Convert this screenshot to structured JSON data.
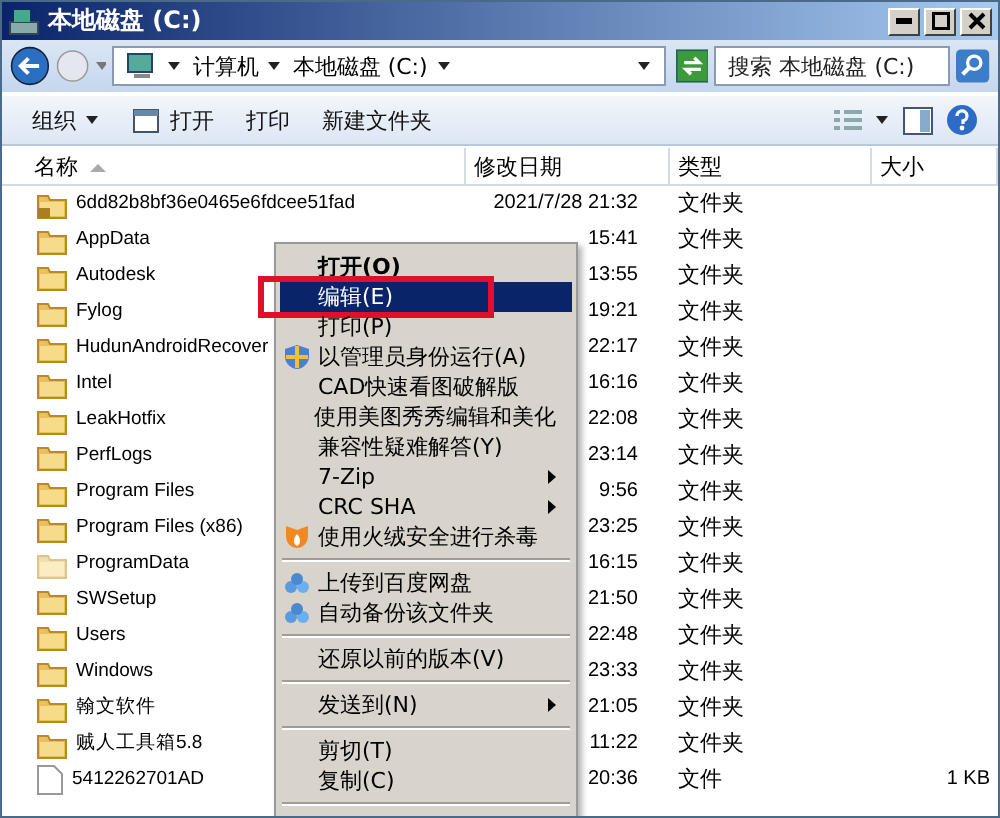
{
  "window": {
    "title": "本地磁盘 (C:)"
  },
  "address": {
    "crumbs": [
      "计算机",
      "本地磁盘 (C:)"
    ]
  },
  "search": {
    "placeholder": "搜索 本地磁盘 (C:)"
  },
  "toolbar": [
    {
      "label": "组织",
      "kind": "menu"
    },
    {
      "label": "打开",
      "kind": "icon"
    },
    {
      "label": "打印",
      "kind": "plain"
    },
    {
      "label": "新建文件夹",
      "kind": "plain"
    }
  ],
  "columns": [
    "名称",
    "修改日期",
    "类型",
    "大小"
  ],
  "rows": [
    {
      "name": "6dd82b8bf36e0465e6fdcee51fad",
      "date": "2021/7/28 21:32",
      "type": "文件夹",
      "kind": "locked"
    },
    {
      "name": "AppData",
      "date": "15:41",
      "type": "文件夹",
      "kind": "folder"
    },
    {
      "name": "Autodesk",
      "date": "13:55",
      "type": "文件夹",
      "kind": "folder"
    },
    {
      "name": "Fylog",
      "date": "19:21",
      "type": "文件夹",
      "kind": "folder"
    },
    {
      "name": "HudunAndroidRecover",
      "date": "22:17",
      "type": "文件夹",
      "kind": "folder"
    },
    {
      "name": "Intel",
      "date": "16:16",
      "type": "文件夹",
      "kind": "folder"
    },
    {
      "name": "LeakHotfix",
      "date": "22:08",
      "type": "文件夹",
      "kind": "folder"
    },
    {
      "name": "PerfLogs",
      "date": "23:14",
      "type": "文件夹",
      "kind": "folder"
    },
    {
      "name": "Program Files",
      "date": "9:56",
      "type": "文件夹",
      "kind": "folder"
    },
    {
      "name": "Program Files (x86)",
      "date": "23:25",
      "type": "文件夹",
      "kind": "folder"
    },
    {
      "name": "ProgramData",
      "date": "16:15",
      "type": "文件夹",
      "kind": "hidden"
    },
    {
      "name": "SWSetup",
      "date": "21:50",
      "type": "文件夹",
      "kind": "folder"
    },
    {
      "name": "Users",
      "date": "22:48",
      "type": "文件夹",
      "kind": "folder"
    },
    {
      "name": "Windows",
      "date": "23:33",
      "type": "文件夹",
      "kind": "folder"
    },
    {
      "name": "翰文软件",
      "date": "21:05",
      "type": "文件夹",
      "kind": "folder"
    },
    {
      "name": "贼人工具箱5.8",
      "date": "11:22",
      "type": "文件夹",
      "kind": "folder"
    },
    {
      "name": "5412262701AD",
      "date": "20:36",
      "type": "文件",
      "size": "1 KB",
      "kind": "file"
    }
  ],
  "context_menu": [
    {
      "kind": "plain",
      "label": "打开(O)",
      "default": true,
      "selected": false
    },
    {
      "kind": "plain",
      "label": "编辑(E)",
      "selected": true
    },
    {
      "kind": "plain",
      "label": "打印(P)",
      "selected": false
    },
    {
      "kind": "shield",
      "label": "以管理员身份运行(A)",
      "selected": false
    },
    {
      "kind": "plain",
      "label": "CAD快速看图破解版",
      "selected": false
    },
    {
      "kind": "plain",
      "label": "使用美图秀秀编辑和美化",
      "selected": false
    },
    {
      "kind": "plain",
      "label": "兼容性疑难解答(Y)",
      "selected": false
    },
    {
      "kind": "plain",
      "label": "7-Zip",
      "submenu": true,
      "selected": false
    },
    {
      "kind": "plain",
      "label": "CRC SHA",
      "submenu": true,
      "selected": false
    },
    {
      "kind": "flame",
      "label": "使用火绒安全进行杀毒",
      "selected": false
    },
    {
      "kind": "separator"
    },
    {
      "kind": "cloud",
      "label": "上传到百度网盘",
      "selected": false
    },
    {
      "kind": "cloud",
      "label": "自动备份该文件夹",
      "selected": false
    },
    {
      "kind": "separator"
    },
    {
      "kind": "plain",
      "label": "还原以前的版本(V)",
      "selected": false
    },
    {
      "kind": "separator"
    },
    {
      "kind": "plain",
      "label": "发送到(N)",
      "submenu": true,
      "selected": false
    },
    {
      "kind": "separator"
    },
    {
      "kind": "plain",
      "label": "剪切(T)",
      "selected": false
    },
    {
      "kind": "plain",
      "label": "复制(C)",
      "selected": false
    },
    {
      "kind": "separator"
    }
  ]
}
